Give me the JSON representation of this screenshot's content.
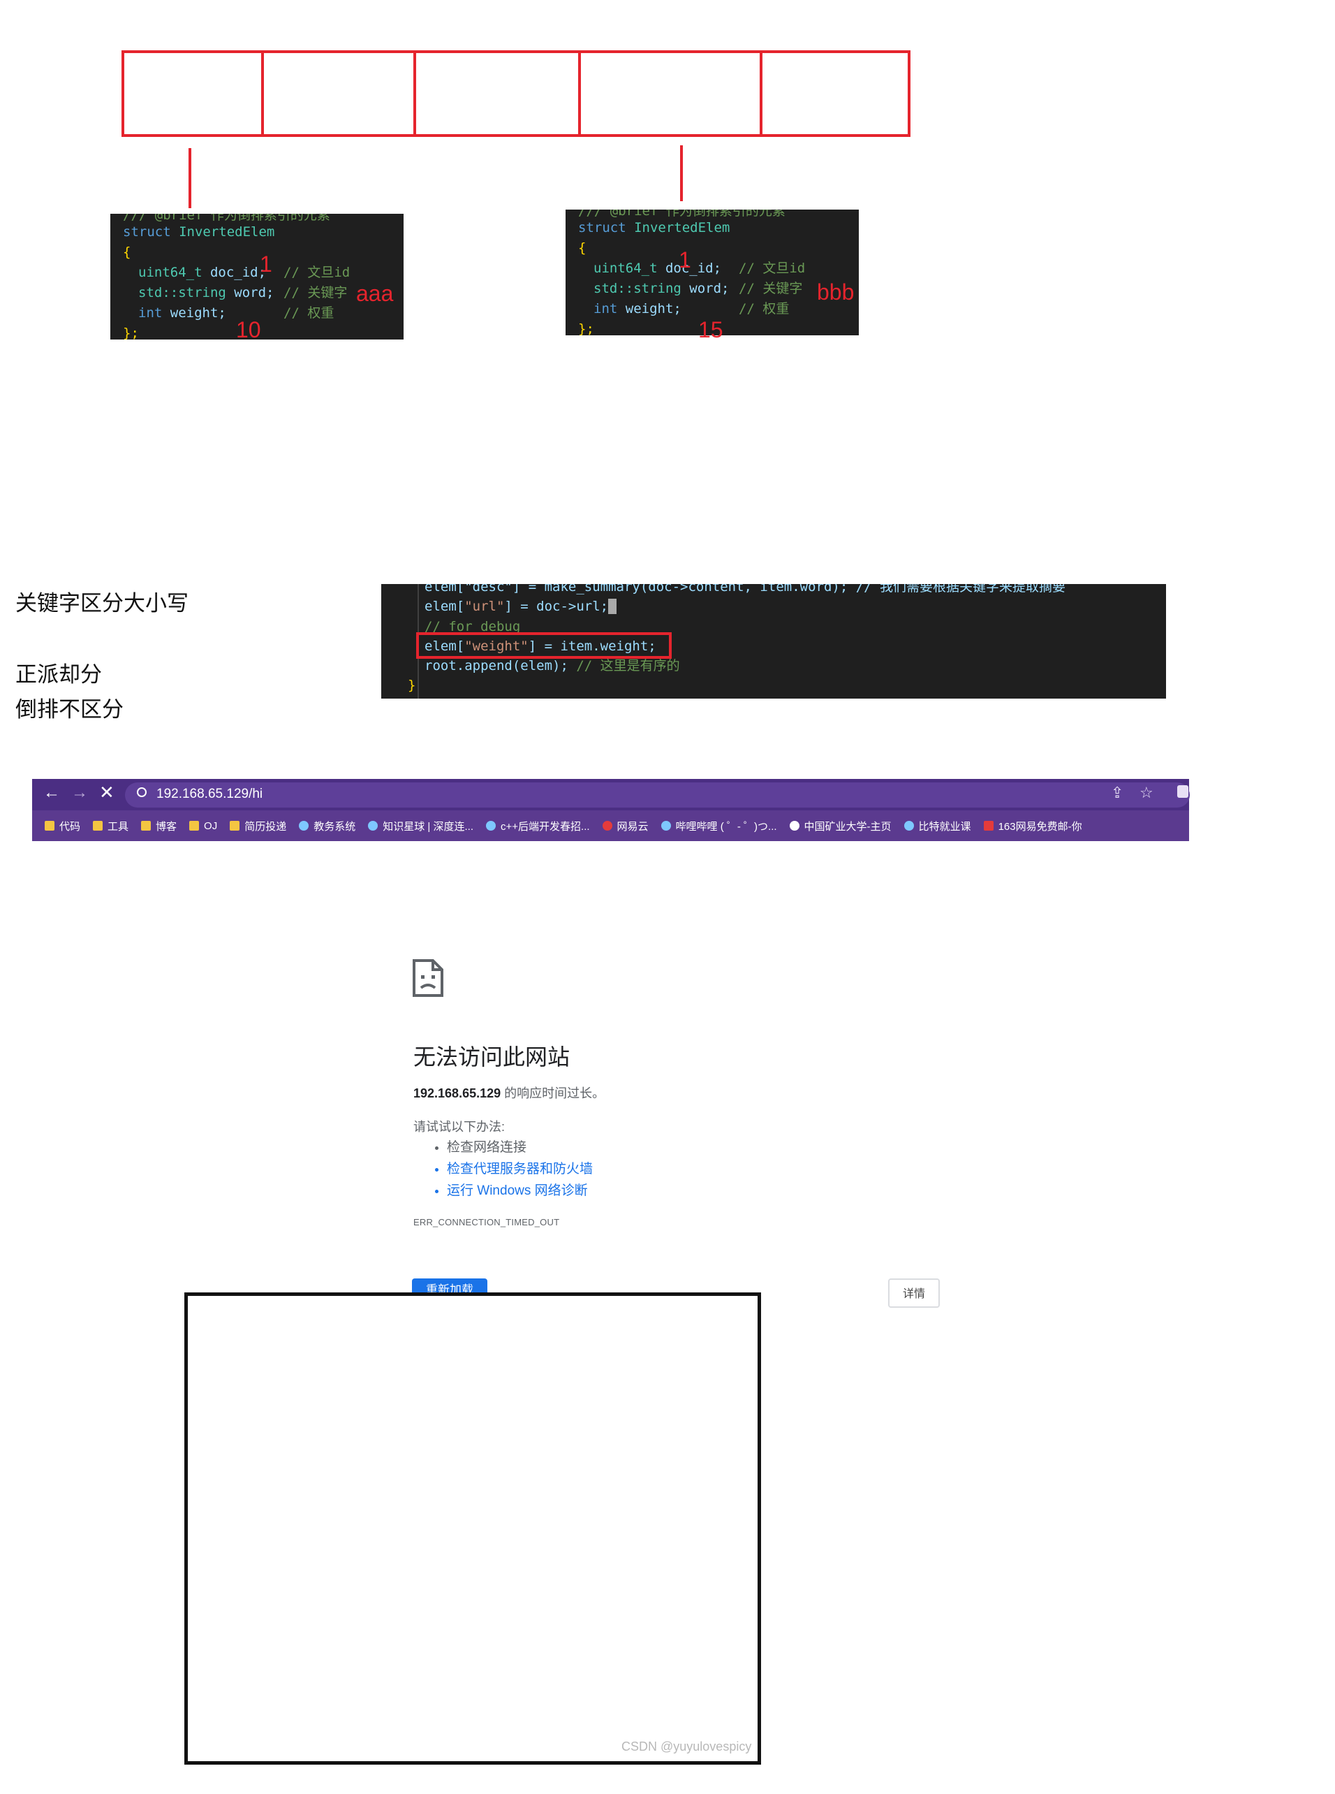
{
  "diagram": {
    "cells": [
      "",
      "",
      "",
      "",
      ""
    ],
    "left_snippet": {
      "lines": [
        {
          "kw": "struct",
          "name": "InvertedElem"
        },
        {
          "text": "{"
        },
        {
          "type": "uint64_t",
          "field": "doc_id;",
          "comment": "// 文旦id"
        },
        {
          "type": "std::string",
          "field": "word;",
          "comment": "// 关键字"
        },
        {
          "type": "int",
          "field": "weight;",
          "comment": "// 权重"
        },
        {
          "text": "};"
        }
      ],
      "note_id": "1",
      "note_word": "aaa",
      "note_weight": "10"
    },
    "right_snippet": {
      "lines": [
        {
          "kw": "struct",
          "name": "InvertedElem"
        },
        {
          "text": "{"
        },
        {
          "type": "uint64_t",
          "field": "doc_id;",
          "comment": "// 文旦id"
        },
        {
          "type": "std::string",
          "field": "word;",
          "comment": "// 关键字"
        },
        {
          "type": "int",
          "field": "weight;",
          "comment": "// 权重"
        },
        {
          "text": "};"
        }
      ],
      "note_id": "1",
      "note_word": "bbb",
      "note_weight": "15"
    }
  },
  "notes": {
    "case_sensitive": "关键字区分大小写",
    "forward_lowercase": "正派却分",
    "inverted_nocase": "倒排不区分"
  },
  "code_block": {
    "line1": "elem[\"desc\"] = make_summary(doc->content, item.word); // 我们需要根据关键字来提取摘要",
    "line2_a": "elem[",
    "line2_key": "\"url\"",
    "line2_b": "] = doc->url;",
    "line3": "// for debug",
    "line4_a": "elem[",
    "line4_key": "\"weight\"",
    "line4_b": "] = item.weight;",
    "line5_a": "root.append(elem);",
    "line5_comment": " // 这里是有序的",
    "line6": "}"
  },
  "browser": {
    "url": "192.168.65.129/hi",
    "bookmarks": [
      {
        "label": "代码",
        "icon": "folder-icon"
      },
      {
        "label": "工具",
        "icon": "folder-icon"
      },
      {
        "label": "博客",
        "icon": "folder-icon"
      },
      {
        "label": "OJ",
        "icon": "folder-icon"
      },
      {
        "label": "简历投递",
        "icon": "folder-icon"
      },
      {
        "label": "教务系统",
        "icon": "leaf-icon"
      },
      {
        "label": "知识星球 | 深度连...",
        "icon": "circle-icon"
      },
      {
        "label": "c++后端开发春招...",
        "icon": "circle-icon"
      },
      {
        "label": "网易云",
        "icon": "netease-icon"
      },
      {
        "label": "哔哩哔哩 ( ゜- ゜)つ...",
        "icon": "tv-icon"
      },
      {
        "label": "中国矿业大学-主页",
        "icon": "circle-icon"
      },
      {
        "label": "比特就业课",
        "icon": "leaf-icon"
      },
      {
        "label": "163网易免费邮-你",
        "icon": "mail-icon"
      }
    ]
  },
  "error_page": {
    "title": "无法访问此网站",
    "host": "192.168.65.129",
    "host_suffix": " 的响应时间过长。",
    "try_label": "请试试以下办法:",
    "suggestions": [
      "检查网络连接",
      "检查代理服务器和防火墙",
      "运行 Windows 网络诊断"
    ],
    "error_code": "ERR_CONNECTION_TIMED_OUT",
    "reload_label": "重新加载",
    "details_label": "详情"
  },
  "watermark": "CSDN @yuyulovespicy",
  "colors": {
    "accent_red": "#e5242d",
    "browser_purple": "#5b3a8f",
    "link_blue": "#1a73e8"
  }
}
